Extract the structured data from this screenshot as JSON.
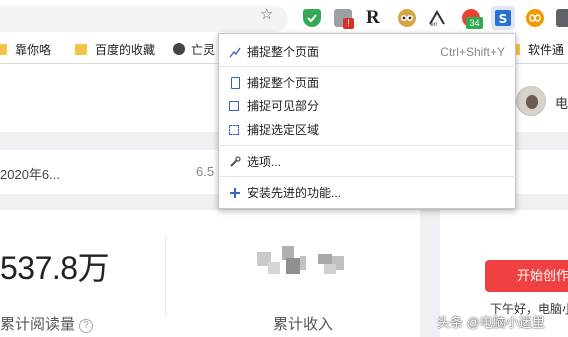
{
  "toolbar": {
    "extensions": [
      "shield-extension",
      "tool-extension",
      "r-extension",
      "owl-extension",
      "translate-extension",
      "notification-extension",
      "screenshot-extension",
      "loop-extension",
      "camera-extension"
    ],
    "badges": {
      "tool": "!",
      "notification": "34"
    },
    "r_letter": "R"
  },
  "bookmarks": [
    {
      "label": "靠你咯",
      "icon": "folder-icon"
    },
    {
      "label": "百度的收藏",
      "icon": "folder-icon"
    },
    {
      "label": "亡灵",
      "icon": "globe-icon"
    },
    {
      "label": "软件通",
      "icon": "folder-icon"
    }
  ],
  "menu": {
    "items": [
      {
        "label": "捕捉整个页面",
        "shortcut": "Ctrl+Shift+Y",
        "icon": "capture-page-icon"
      },
      {
        "label": "捕捉整个页面",
        "icon": "page-icon"
      },
      {
        "label": "捕捉可见部分",
        "icon": "visible-area-icon"
      },
      {
        "label": "捕捉选定区域",
        "icon": "region-select-icon"
      },
      {
        "label": "选项...",
        "icon": "tools-icon"
      },
      {
        "label": "安装先进的功能...",
        "icon": "plus-icon"
      }
    ]
  },
  "header": {
    "username": "电"
  },
  "stats": {
    "date": "2020年6...",
    "number": "6.5",
    "total_reads": "537.8万",
    "total_reads_label": "累计阅读量",
    "total_income_label": "累计收入",
    "help_icon": "?"
  },
  "sidebar": {
    "create_button": "开始创作",
    "greeting": "下午好，电脑小"
  },
  "watermark": "头条 @电脑小迷里",
  "colors": {
    "accent_red": "#f04142",
    "menu_icon_blue": "#3a64b8"
  }
}
